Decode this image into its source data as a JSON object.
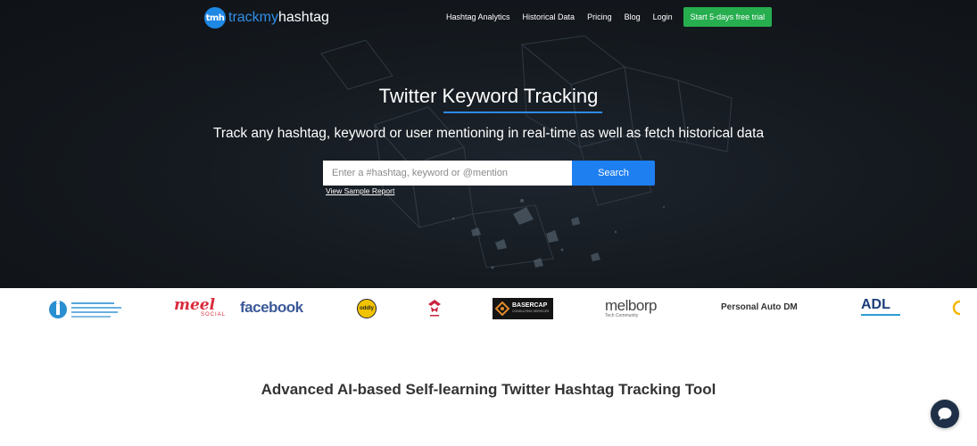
{
  "brand": {
    "logo_mark": "tmh",
    "name_part1": "trackmy",
    "name_part2": "hashtag",
    "accent_color": "#1e88e5"
  },
  "nav": {
    "links": [
      "Hashtag Analytics",
      "Historical Data",
      "Pricing",
      "Blog",
      "Login"
    ],
    "cta_label": "Start 5-days free trial",
    "cta_color": "#27ae4f"
  },
  "hero": {
    "title": "Twitter Keyword Tracking",
    "subtitle": "Track any hashtag, keyword or user mentioning in real-time as well as fetch historical data",
    "search_placeholder": "Enter a #hashtag, keyword or @mention",
    "search_button": "Search",
    "sample_link": "View Sample Report"
  },
  "clients": {
    "meel": "meel",
    "meel_sub": "SOCIAL",
    "facebook": "facebook",
    "oddly": "oddly",
    "basercap": "BASERCAP",
    "basercap_sub": "CONSULTING SERVICES",
    "melbo": "melbo",
    "melbo_tail": "rp",
    "melbo_sub": "Tech Community",
    "personal_auto": "Personal Auto DM",
    "adl": "ADL"
  },
  "section": {
    "heading": "Advanced AI-based Self-learning Twitter Hashtag Tracking Tool"
  },
  "chat": {
    "icon": "chat-icon"
  }
}
